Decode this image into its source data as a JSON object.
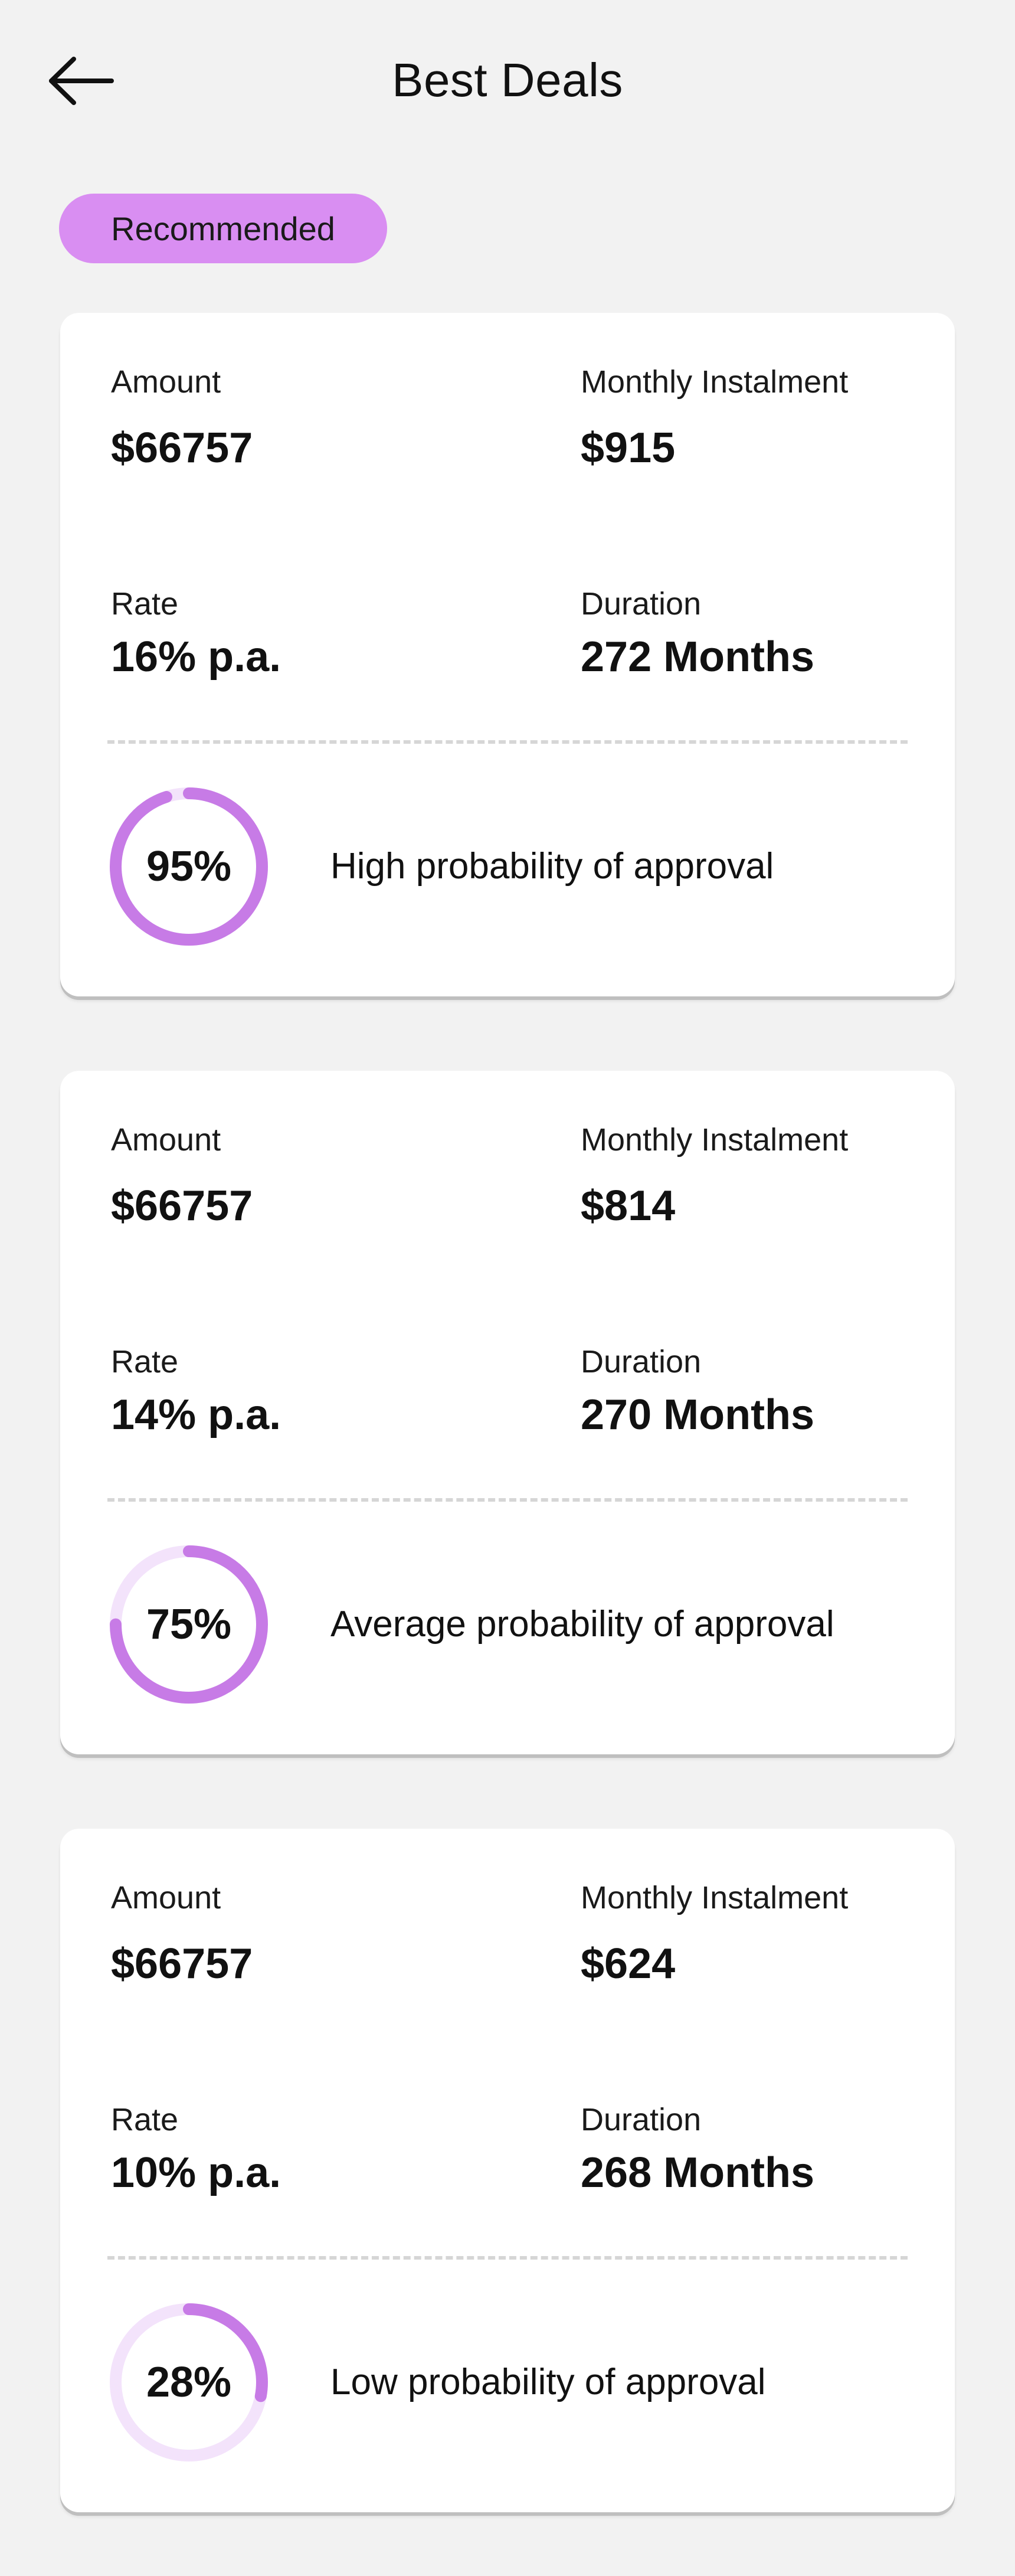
{
  "header": {
    "title": "Best Deals",
    "back_icon": "arrow-left-icon"
  },
  "badge": {
    "label": "Recommended",
    "color": "#d98ef2"
  },
  "labels": {
    "amount": "Amount",
    "monthly_instalment": "Monthly Instalment",
    "rate": "Rate",
    "duration": "Duration"
  },
  "colors": {
    "accent": "#c77be6",
    "track": "#f3e3fb"
  },
  "deals": [
    {
      "amount": "$66757",
      "monthly_instalment": "$915",
      "rate": "16% p.a.",
      "duration": "272 Months",
      "probability_text": "95%",
      "probability": 0.95,
      "approval_text": "High probability of approval"
    },
    {
      "amount": "$66757",
      "monthly_instalment": "$814",
      "rate": "14% p.a.",
      "duration": "270 Months",
      "probability_text": "75%",
      "probability": 0.75,
      "approval_text": "Average probability of approval"
    },
    {
      "amount": "$66757",
      "monthly_instalment": "$624",
      "rate": "10% p.a.",
      "duration": "268 Months",
      "probability_text": "28%",
      "probability": 0.28,
      "approval_text": "Low probability of approval"
    }
  ]
}
